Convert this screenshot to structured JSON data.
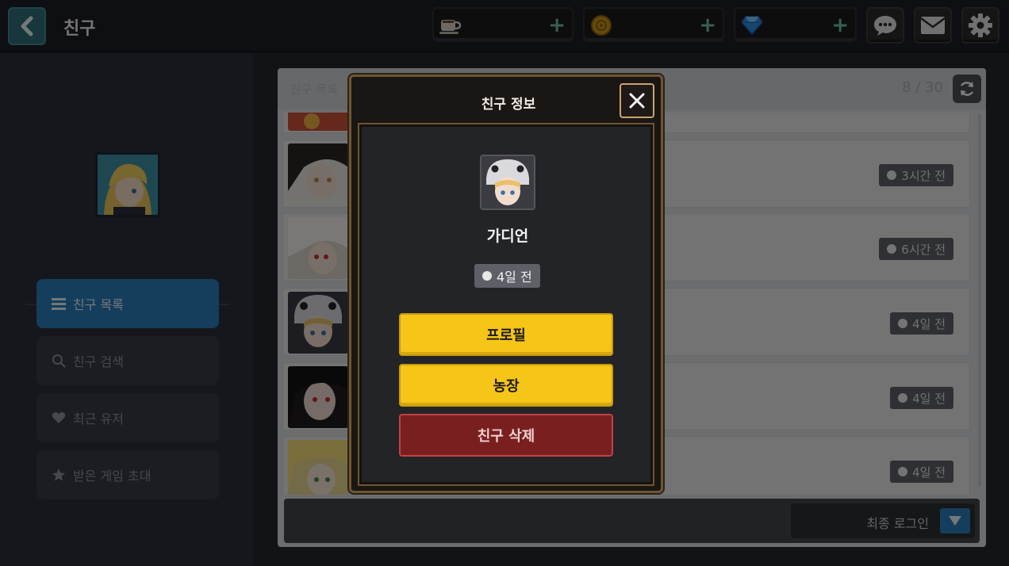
{
  "header": {
    "title": "친구",
    "resources": [
      {
        "icon": "coffee-cup-icon",
        "value": ""
      },
      {
        "icon": "gold-coin-icon",
        "value": ""
      },
      {
        "icon": "diamond-gem-icon",
        "value": ""
      }
    ],
    "icons": [
      "chat-bubble-icon",
      "mail-envelope-icon",
      "settings-gear-icon"
    ]
  },
  "sidebar": {
    "items": [
      {
        "label": "친구 목록",
        "icon": "list-icon",
        "active": true
      },
      {
        "label": "친구 검색",
        "icon": "search-icon",
        "active": false
      },
      {
        "label": "최근 유저",
        "icon": "heart-icon",
        "active": false
      },
      {
        "label": "받은 게임 초대",
        "icon": "star-icon",
        "active": false
      }
    ]
  },
  "friend_list": {
    "label": "친구 목록",
    "count": "8 / 30",
    "rows": [
      {
        "time": "3시간 전"
      },
      {
        "time": "6시간 전"
      },
      {
        "time": "4일 전"
      },
      {
        "time": "4일 전"
      },
      {
        "time": "4일 전"
      }
    ],
    "sort_label": "최종 로그인"
  },
  "modal": {
    "title": "친구 정보",
    "name": "가디언",
    "last_seen": "4일 전",
    "profile_button": "프로필",
    "farm_button": "농장",
    "delete_button": "친구 삭제"
  },
  "colors": {
    "accent_blue": "#2a7bb8",
    "button_yellow": "#f5c518",
    "delete_red": "#7a1f1f",
    "frame_gold": "#c9a66a"
  }
}
